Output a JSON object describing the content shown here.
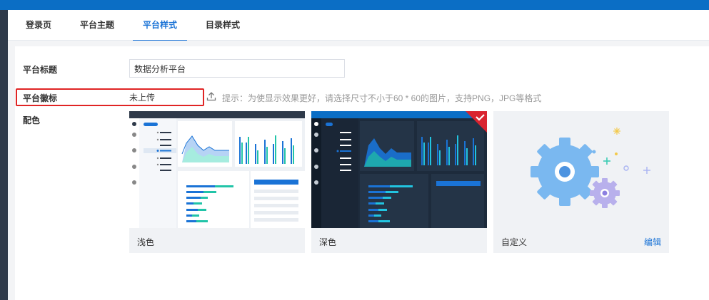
{
  "tabs": [
    {
      "label": "登录页",
      "active": false
    },
    {
      "label": "平台主题",
      "active": false
    },
    {
      "label": "平台样式",
      "active": true
    },
    {
      "label": "目录样式",
      "active": false
    }
  ],
  "form": {
    "title_label": "平台标题",
    "title_value": "数据分析平台",
    "logo_label": "平台徽标",
    "logo_status": "未上传",
    "logo_hint": "提示：为使显示效果更好，请选择尺寸不小于60 * 60的图片，支持PNG，JPG等格式",
    "color_label": "配色"
  },
  "themes": [
    {
      "name": "浅色",
      "selected": false
    },
    {
      "name": "深色",
      "selected": true
    },
    {
      "name": "自定义",
      "selected": false,
      "action": "编辑"
    }
  ],
  "colors": {
    "accent": "#1a73d6",
    "topbar": "#0b6ec5",
    "highlight": "#e02424",
    "check": "#d9232f"
  }
}
